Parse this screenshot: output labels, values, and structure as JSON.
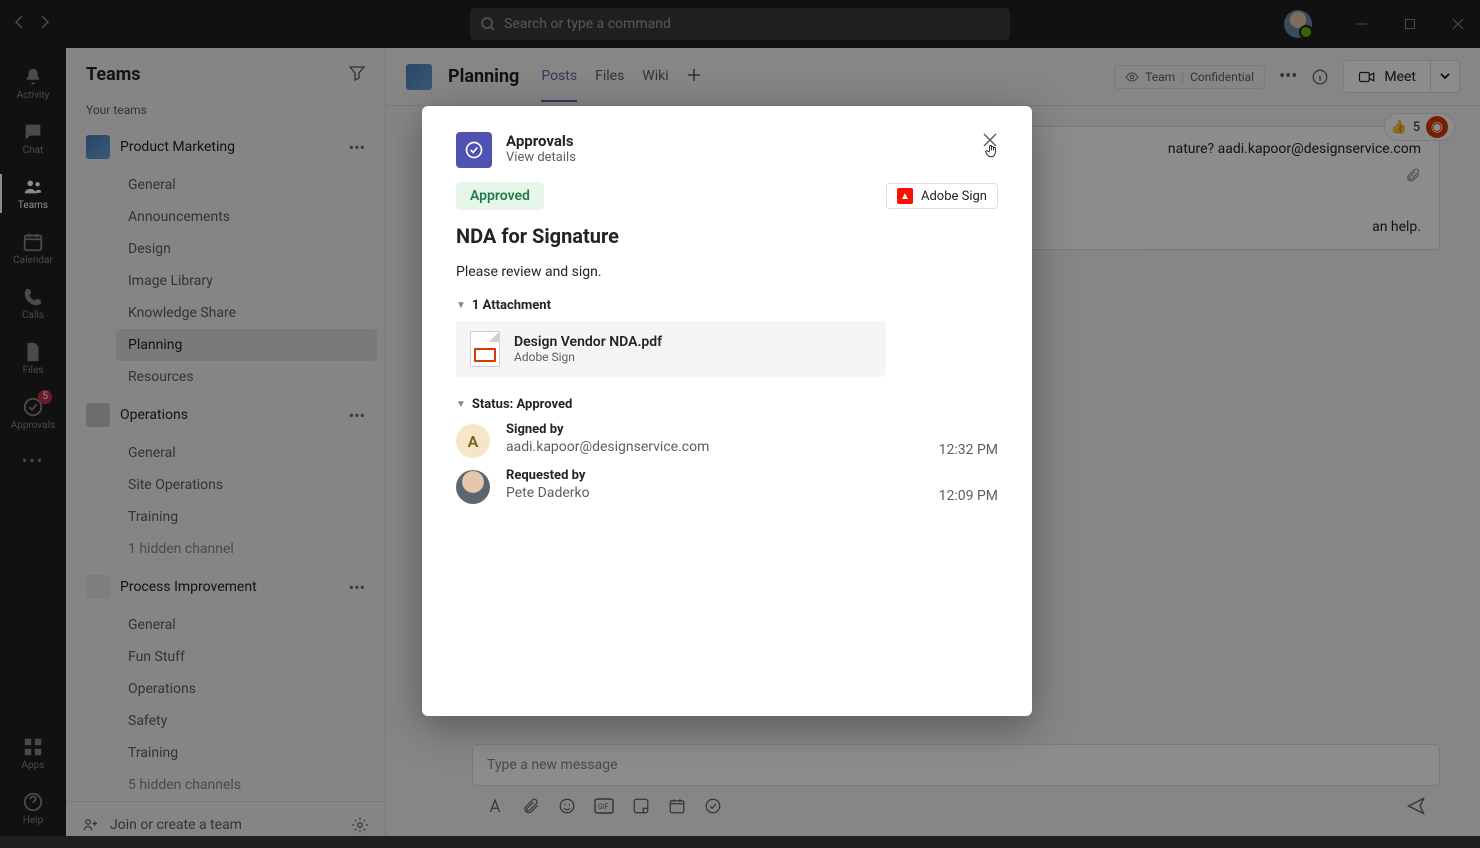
{
  "search": {
    "placeholder": "Search or type a command"
  },
  "rail": {
    "items": [
      {
        "id": "activity",
        "label": "Activity"
      },
      {
        "id": "chat",
        "label": "Chat"
      },
      {
        "id": "teams",
        "label": "Teams",
        "active": true
      },
      {
        "id": "calendar",
        "label": "Calendar"
      },
      {
        "id": "calls",
        "label": "Calls"
      },
      {
        "id": "files",
        "label": "Files"
      },
      {
        "id": "approvals",
        "label": "Approvals",
        "badge": "5"
      }
    ],
    "more": "•••",
    "apps_label": "Apps",
    "help_label": "Help"
  },
  "sidebar": {
    "title": "Teams",
    "section": "Your teams",
    "teams": [
      {
        "name": "Product Marketing",
        "channels": [
          "General",
          "Announcements",
          "Design",
          "Image Library",
          "Knowledge Share",
          "Planning",
          "Resources"
        ],
        "active_channel": "Planning"
      },
      {
        "name": "Operations",
        "channels": [
          "General",
          "Site Operations",
          "Training"
        ],
        "hidden_label": "1 hidden channel"
      },
      {
        "name": "Process Improvement",
        "channels": [
          "General",
          "Fun Stuff",
          "Operations",
          "Safety",
          "Training"
        ],
        "hidden_label": "5 hidden channels"
      }
    ],
    "footer": "Join or create a team"
  },
  "header": {
    "channel": "Planning",
    "tabs": [
      "Posts",
      "Files",
      "Wiki"
    ],
    "active_tab": "Posts",
    "sensitivity_team": "Team",
    "sensitivity_level": "Confidential",
    "meet": "Meet"
  },
  "post": {
    "line1_tail": "nature? aadi.kapoor@designservice.com",
    "line2_tail": "an help."
  },
  "compose": {
    "placeholder": "Type a new message"
  },
  "reactions": {
    "count": "5"
  },
  "modal": {
    "app_name": "Approvals",
    "subtitle": "View details",
    "status_pill": "Approved",
    "provider": "Adobe Sign",
    "title": "NDA for Signature",
    "description": "Please review and sign.",
    "attachments_header": "1 Attachment",
    "attachment": {
      "name": "Design Vendor NDA.pdf",
      "provider": "Adobe Sign"
    },
    "status_header": "Status: Approved",
    "timeline": [
      {
        "label": "Signed by",
        "value": "aadi.kapoor@designservice.com",
        "time": "12:32 PM",
        "bullet": "A"
      },
      {
        "label": "Requested by",
        "value": "Pete Daderko",
        "time": "12:09 PM"
      }
    ]
  }
}
